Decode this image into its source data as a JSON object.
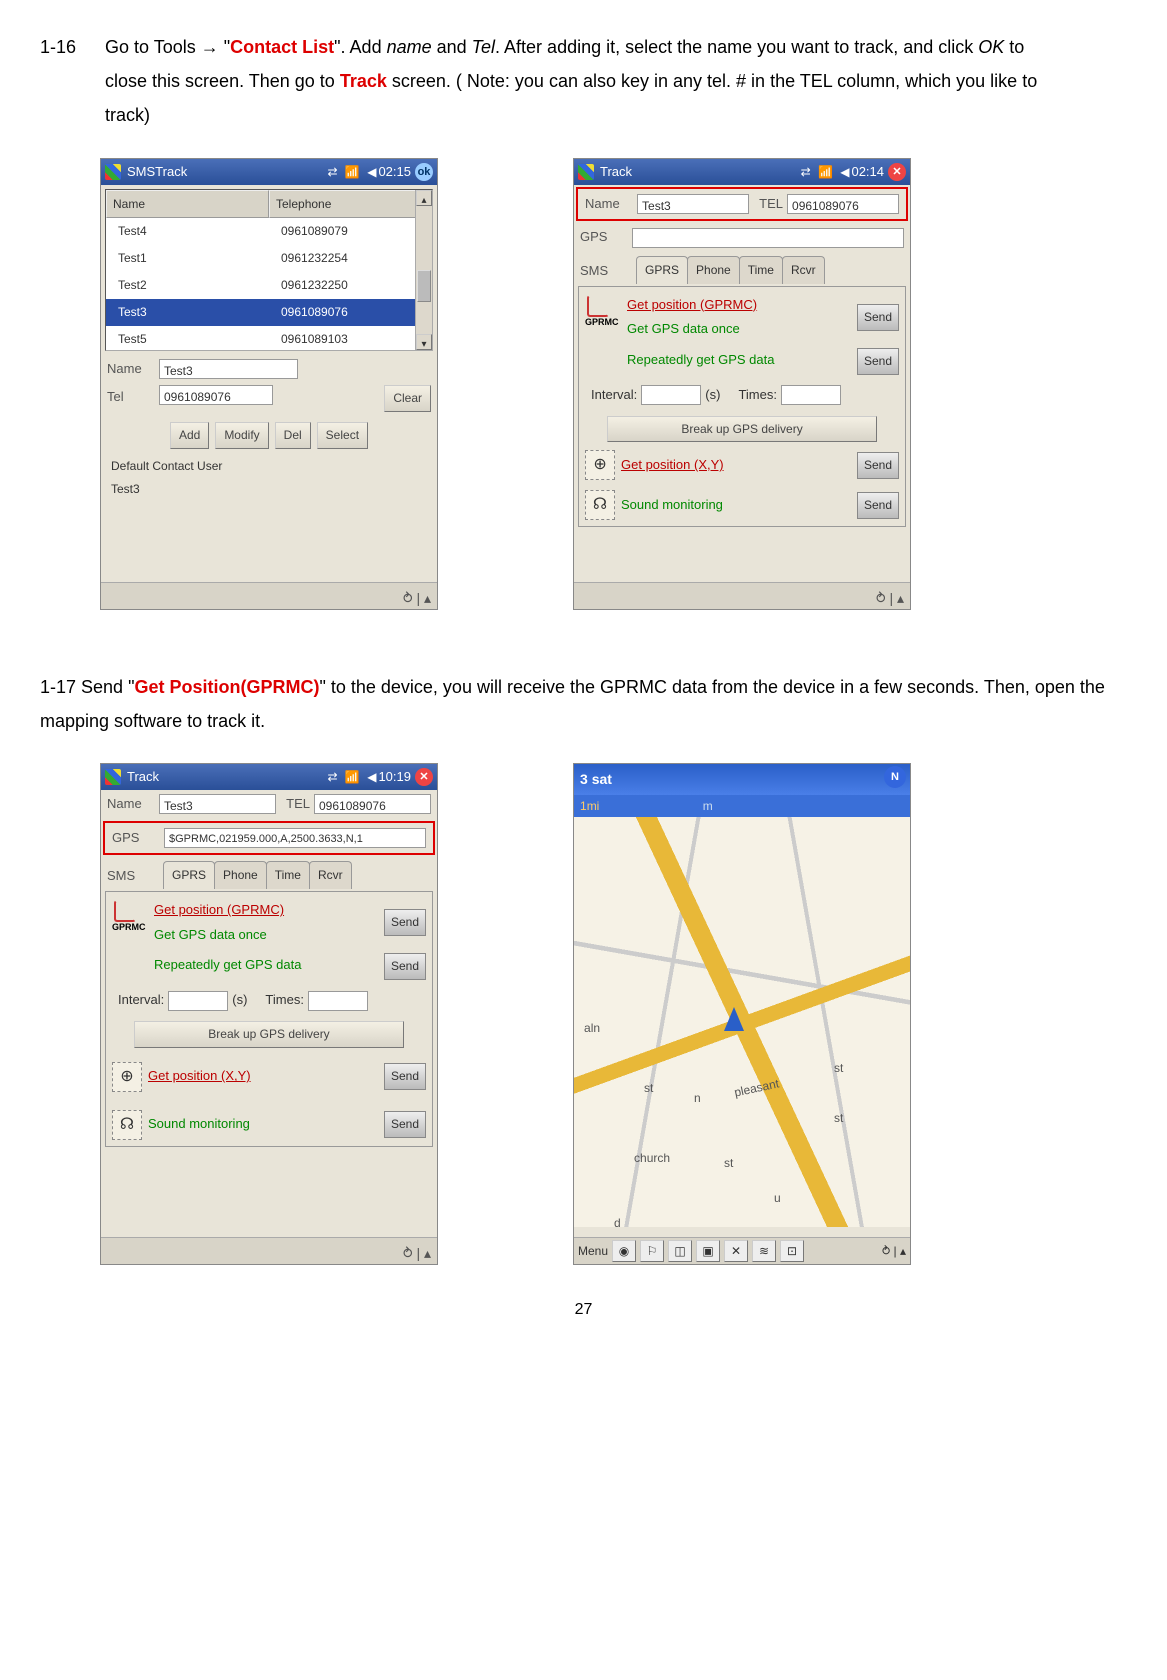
{
  "page_number": "27",
  "step1": {
    "num": "1-16",
    "pre": "Go to Tools ",
    "arrow": "→",
    "q1": " \"",
    "contact_list": "Contact List",
    "mid1": "\". Add ",
    "name_i": "name",
    "mid2": " and ",
    "tel_i": "Tel",
    "mid3": ". After adding it, select the name you want to track, and click ",
    "ok_i": "OK",
    "mid4": " to close this screen. Then go to ",
    "track": "Track",
    "mid5": " screen. ( Note: you can also key in any tel. # in the TEL column, which you like to track)"
  },
  "step2": {
    "num": "1-17",
    "pre": " Send \"",
    "getpos": "Get Position(GPRMC)",
    "mid": "\" to the device, you will receive the GPRMC data from the device in a few seconds. Then, open the mapping software to track it."
  },
  "screenA": {
    "title": "SMSTrack",
    "time": "02:15",
    "ok": "ok",
    "col1": "Name",
    "col2": "Telephone",
    "rows": [
      {
        "n": "Test4",
        "t": "0961089079"
      },
      {
        "n": "Test1",
        "t": "0961232254"
      },
      {
        "n": "Test2",
        "t": "0961232250"
      },
      {
        "n": "Test3",
        "t": "0961089076"
      },
      {
        "n": "Test5",
        "t": "0961089103"
      }
    ],
    "name_lbl": "Name",
    "name_val": "Test3",
    "tel_lbl": "Tel",
    "tel_val": "0961089076",
    "clear": "Clear",
    "add": "Add",
    "modify": "Modify",
    "del": "Del",
    "select": "Select",
    "default_lbl": "Default Contact User",
    "default_val": "Test3"
  },
  "track_common": {
    "title": "Track",
    "name_lbl": "Name",
    "name_val": "Test3",
    "tel_lbl": "TEL",
    "tel_val": "0961089076",
    "gps_lbl": "GPS",
    "sms_lbl": "SMS",
    "tabs": [
      "GPRS",
      "Phone",
      "Time",
      "Rcvr"
    ],
    "getpos": "Get position (GPRMC)",
    "once": "Get GPS data once",
    "repeat": "Repeatedly get GPS data",
    "send": "Send",
    "interval": "Interval:",
    "s": "(s)",
    "times": "Times:",
    "breakup": "Break up GPS delivery",
    "getxy": "Get position (X,Y)",
    "sound": "Sound monitoring",
    "gprmc_tag": "GPRMC"
  },
  "screenB": {
    "time": "02:14",
    "close": "✕",
    "gps_val": ""
  },
  "screenC": {
    "time": "10:19",
    "close": "✕",
    "gps_val": "$GPRMC,021959.000,A,2500.3633,N,1"
  },
  "screenD": {
    "sat": "3 sat",
    "scale": "1mi",
    "m": "m",
    "n": "N",
    "labels": [
      "aln",
      "st",
      "n",
      "pleasant",
      "st",
      "st",
      "church",
      "st",
      "u",
      "d"
    ],
    "menu": "Menu"
  }
}
